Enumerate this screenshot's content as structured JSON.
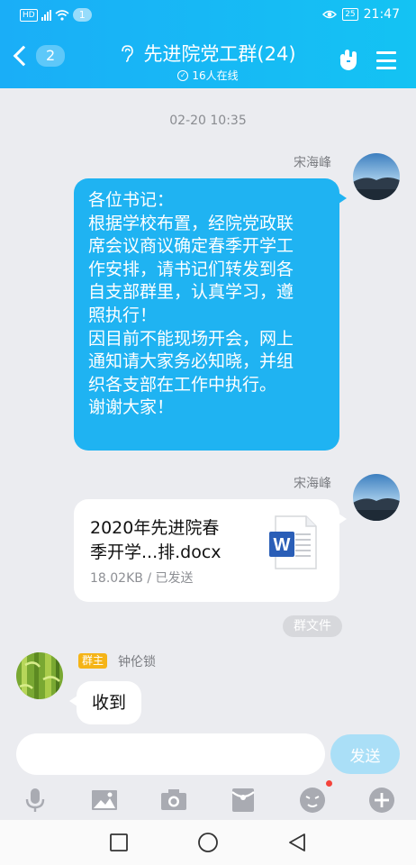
{
  "status_bar": {
    "hd": "HD",
    "notif_count": "1",
    "battery": "25",
    "time": "21:47"
  },
  "header": {
    "back_count": "2",
    "title": "先进院党工群(24)",
    "online": "16人在线"
  },
  "chat": {
    "timestamp": "02-20 10:35",
    "msg1": {
      "sender": "宋海峰",
      "lines": [
        "各位书记：",
        "根据学校布置，经院党政联",
        "席会议商议确定春季开学工",
        "作安排，请书记们转发到各",
        "自支部群里，认真学习，遵",
        "照执行！",
        "因目前不能现场开会，网上",
        "通知请大家务必知晓，并组",
        "织各支部在工作中执行。",
        "谢谢大家！"
      ]
    },
    "msg2": {
      "sender": "宋海峰",
      "file_line1": "2020年先进院春",
      "file_line2": "季开学...排.docx",
      "file_meta": "18.02KB / 已发送",
      "file_icon_letter": "W"
    },
    "tag": "群文件",
    "msg3": {
      "role_badge": "群主",
      "sender": "钟伦锁",
      "text": "收到"
    }
  },
  "input": {
    "placeholder": "",
    "send_label": "发送"
  },
  "toolbar": [
    "microphone-icon",
    "image-icon",
    "camera-icon",
    "red-packet-icon",
    "emoji-icon",
    "plus-icon"
  ],
  "colors": {
    "header_start": "#1aaef7",
    "header_end": "#14c3f3",
    "bubble": "#1fb3f2",
    "send_disabled": "#aadff7",
    "badge": "#f5b417"
  }
}
